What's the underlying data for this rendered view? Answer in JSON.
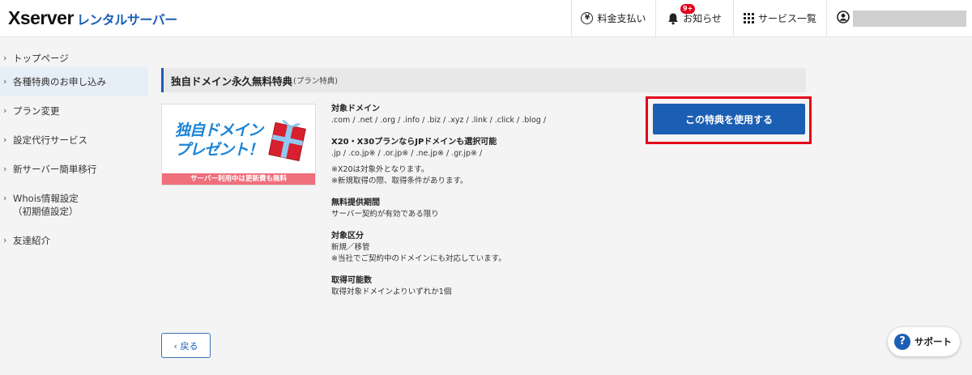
{
  "header": {
    "logo_main": "Xserver",
    "logo_sub": "レンタルサーバー",
    "nav": {
      "pay": "料金支払い",
      "news": "お知らせ",
      "news_badge": "9+",
      "services": "サービス一覧",
      "user_name_redacted": ""
    }
  },
  "sidebar": {
    "items": [
      {
        "label": "トップページ"
      },
      {
        "label": "各種特典のお申し込み"
      },
      {
        "label": "プラン変更"
      },
      {
        "label": "設定代行サービス"
      },
      {
        "label": "新サーバー簡単移行"
      },
      {
        "label": "Whois情報設定",
        "label2": "（初期値設定）"
      },
      {
        "label": "友達紹介"
      }
    ]
  },
  "main": {
    "section_title": "独自ドメイン永久無料特典",
    "section_note": "(プラン特典)",
    "banner": {
      "line1": "独自ドメイン",
      "line2": "プレゼント！",
      "strip": "サーバー利用中は更新費も無料"
    },
    "details": [
      {
        "label": "対象ドメイン",
        "lines": [
          ".com / .net / .org / .info / .biz / .xyz / .link / .click / .blog /"
        ]
      },
      {
        "label": "X20・X30プランならJPドメインも選択可能",
        "lines": [
          ".jp / .co.jp※ / .or.jp※ / .ne.jp※ / .gr.jp※ /",
          "",
          "※X20は対象外となります。",
          "※新規取得の際、取得条件があります。"
        ]
      },
      {
        "label": "無料提供期間",
        "lines": [
          "サーバー契約が有効である限り"
        ]
      },
      {
        "label": "対象区分",
        "lines": [
          "新規／移管",
          "※当社でご契約中のドメインにも対応しています。"
        ]
      },
      {
        "label": "取得可能数",
        "lines": [
          "取得対象ドメインよりいずれか1個"
        ]
      }
    ],
    "cta_label": "この特典を使用する",
    "back_label": "‹ 戻る"
  },
  "support": {
    "icon": "?",
    "label": "サポート"
  },
  "colors": {
    "brand_blue": "#1b5fb4",
    "highlight_red": "#e3001b",
    "banner_pink": "#ef6f7c"
  }
}
